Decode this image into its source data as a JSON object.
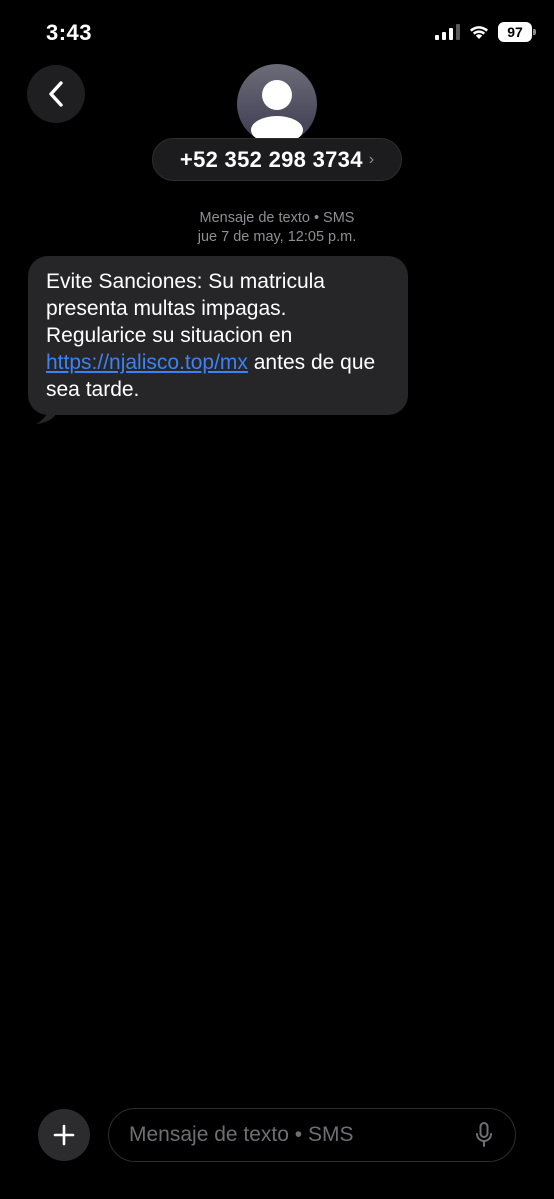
{
  "status_bar": {
    "time": "3:43",
    "battery_level": "97"
  },
  "header": {
    "contact": "+52 352 298 3734",
    "chevron": "›"
  },
  "conversation": {
    "meta_line1": "Mensaje de texto • SMS",
    "meta_line2": "jue 7 de may, 12:05 p.m.",
    "message": {
      "text_before_link": "Evite Sanciones: Su matricula presenta multas impagas. Regularice su situacion en ",
      "link_text": "https://njalisco.top/mx",
      "text_after_link": " antes de que sea tarde."
    }
  },
  "composer": {
    "placeholder": "Mensaje de texto • SMS"
  },
  "colors": {
    "background": "#000000",
    "bubble": "#262628",
    "link": "#3b82f6",
    "meta": "#8e8e93"
  },
  "icons": [
    "back-chevron-icon",
    "contact-avatar-icon",
    "plus-icon",
    "microphone-icon",
    "signal-icon",
    "wifi-icon",
    "battery-icon"
  ]
}
